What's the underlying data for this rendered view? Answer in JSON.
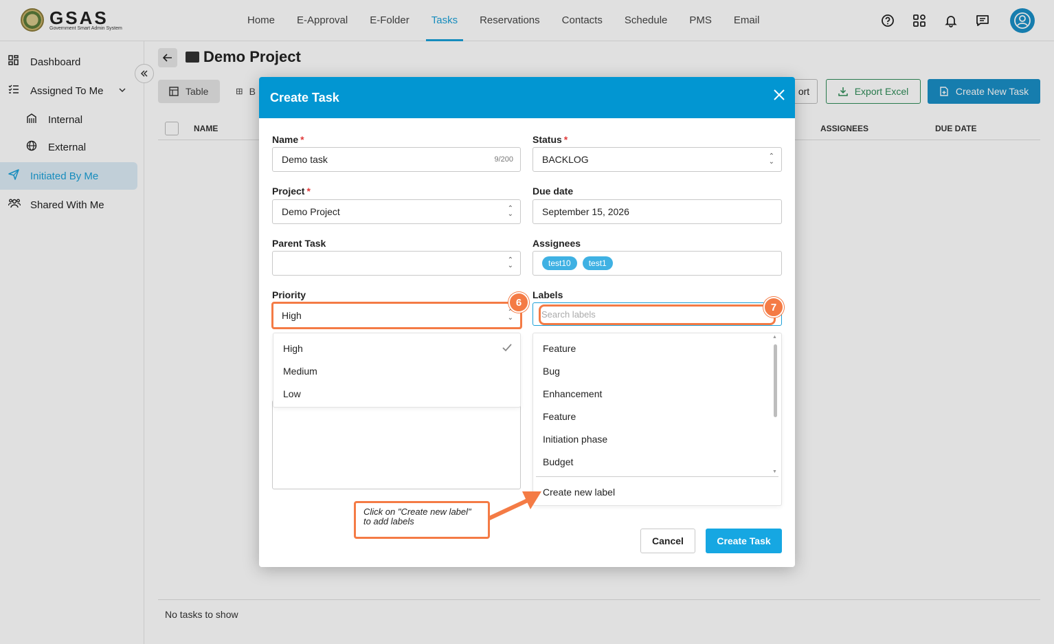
{
  "brand": {
    "name": "GSAS",
    "tagline": "Government Smart Admin System"
  },
  "nav": [
    "Home",
    "E-Approval",
    "E-Folder",
    "Tasks",
    "Reservations",
    "Contacts",
    "Schedule",
    "PMS",
    "Email"
  ],
  "sidebar": {
    "dashboard": "Dashboard",
    "assigned": "Assigned To Me",
    "internal": "Internal",
    "external": "External",
    "initiated": "Initiated By Me",
    "shared": "Shared With Me"
  },
  "page": {
    "title": "Demo Project",
    "tab_table": "Table",
    "tab_board": "B",
    "import_label": "ort",
    "export_label": "Export Excel",
    "create_label": "Create New Task",
    "col_name": "NAME",
    "col_assignees": "ASSIGNEES",
    "col_due": "DUE DATE",
    "empty": "No tasks to show"
  },
  "modal": {
    "title": "Create Task",
    "name_label": "Name",
    "name_value": "Demo task",
    "name_counter": "9/200",
    "status_label": "Status",
    "status_value": "BACKLOG",
    "project_label": "Project",
    "project_value": "Demo Project",
    "due_label": "Due date",
    "due_value": "September 15, 2026",
    "parent_label": "Parent Task",
    "assignees_label": "Assignees",
    "assignees": [
      "test10",
      "test1"
    ],
    "priority_label": "Priority",
    "priority_value": "High",
    "priority_options": [
      "High",
      "Medium",
      "Low"
    ],
    "labels_label": "Labels",
    "labels_placeholder": "Search labels",
    "label_options": [
      "Feature",
      "Bug",
      "Enhancement",
      "Feature",
      "Initiation phase",
      "Budget"
    ],
    "create_label_option": "Create new label",
    "cancel": "Cancel",
    "submit": "Create Task"
  },
  "annotations": {
    "step6": "6",
    "step7": "7",
    "callout_line1": "Click on \"Create new label\"",
    "callout_line2": "to add labels",
    "color": "#f47b45"
  },
  "colors": {
    "primary": "#0296d2",
    "accent": "#1aa0d8",
    "export_green": "#2e8b57"
  }
}
